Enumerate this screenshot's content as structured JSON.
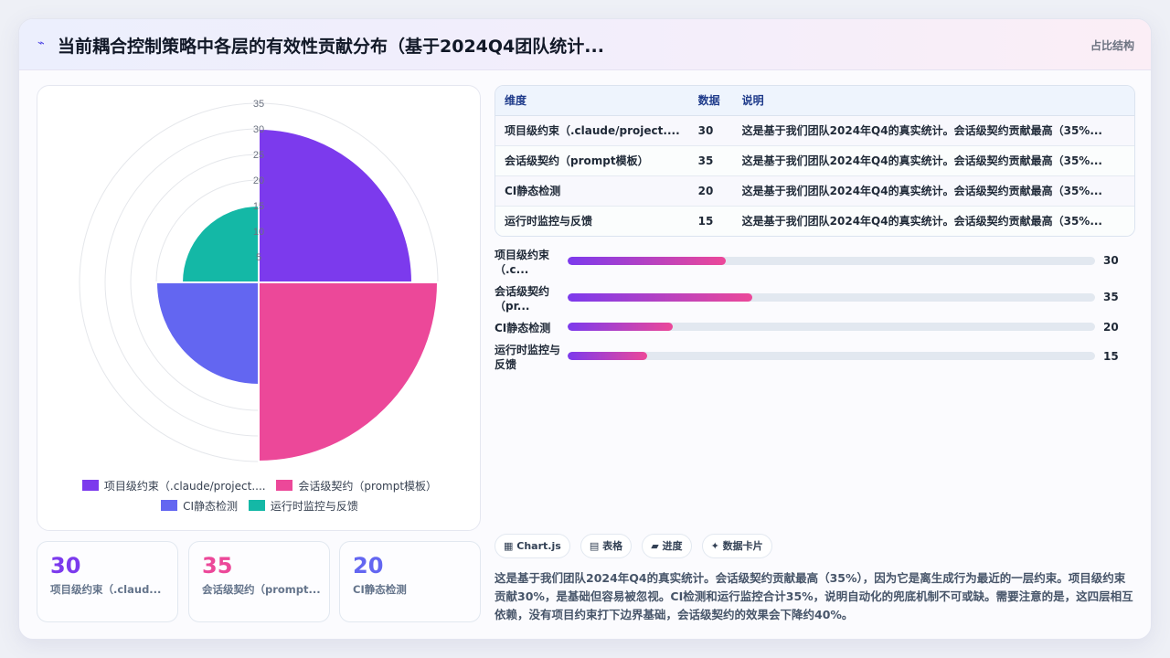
{
  "header": {
    "icon": "chart-line-icon",
    "title": "当前耦合控制策略中各层的有效性贡献分布（基于2024Q4团队统计...",
    "tag": "占比结构"
  },
  "colors": {
    "purple": "#7c3aed",
    "pink": "#ec4899",
    "indigo": "#6366f1",
    "teal": "#14b8a6"
  },
  "chart_data": {
    "type": "polarArea",
    "categories": [
      "项目级约束（.claude/project....",
      "会话级契约（prompt模板）",
      "CI静态检测",
      "运行时监控与反馈"
    ],
    "values": [
      30,
      35,
      20,
      15
    ],
    "colors": [
      "#7c3aed",
      "#ec4899",
      "#6366f1",
      "#14b8a6"
    ],
    "rlim": [
      0,
      35
    ],
    "r_ticks": [
      "5",
      "10",
      "15",
      "20",
      "25",
      "30",
      "35"
    ],
    "grid": true,
    "legend": "bottom"
  },
  "stats": [
    {
      "value": "30",
      "label": "项目级约束（.claud...",
      "color": "#7c3aed"
    },
    {
      "value": "35",
      "label": "会话级契约（prompt...",
      "color": "#ec4899"
    },
    {
      "value": "20",
      "label": "CI静态检测",
      "color": "#6366f1"
    }
  ],
  "table": {
    "headers": [
      "维度",
      "数据",
      "说明"
    ],
    "rows": [
      [
        "项目级约束（.claude/project....",
        "30",
        "这是基于我们团队2024年Q4的真实统计。会话级契约贡献最高（35%..."
      ],
      [
        "会话级契约（prompt模板）",
        "35",
        "这是基于我们团队2024年Q4的真实统计。会话级契约贡献最高（35%..."
      ],
      [
        "CI静态检测",
        "20",
        "这是基于我们团队2024年Q4的真实统计。会话级契约贡献最高（35%..."
      ],
      [
        "运行时监控与反馈",
        "15",
        "这是基于我们团队2024年Q4的真实统计。会话级契约贡献最高（35%..."
      ]
    ]
  },
  "bars": {
    "max": 100,
    "items": [
      {
        "label": "项目级约束（.c...",
        "value": 30
      },
      {
        "label": "会话级契约（pr...",
        "value": 35
      },
      {
        "label": "CI静态检测",
        "value": 20
      },
      {
        "label": "运行时监控与反馈",
        "value": 15
      }
    ]
  },
  "chips": [
    {
      "icon": "chart-icon",
      "glyph": "▦",
      "label": "Chart.js"
    },
    {
      "icon": "table-icon",
      "glyph": "▤",
      "label": "表格"
    },
    {
      "icon": "progress-icon",
      "glyph": "▰",
      "label": "进度"
    },
    {
      "icon": "sparkle-icon",
      "glyph": "✦",
      "label": "数据卡片"
    }
  ],
  "summary": "这是基于我们团队2024年Q4的真实统计。会话级契约贡献最高（35%），因为它是离生成行为最近的一层约束。项目级约束贡献30%，是基础但容易被忽视。CI检测和运行监控合计35%，说明自动化的兜底机制不可或缺。需要注意的是，这四层相互依赖，没有项目约束打下边界基础，会话级契约的效果会下降约40%。"
}
